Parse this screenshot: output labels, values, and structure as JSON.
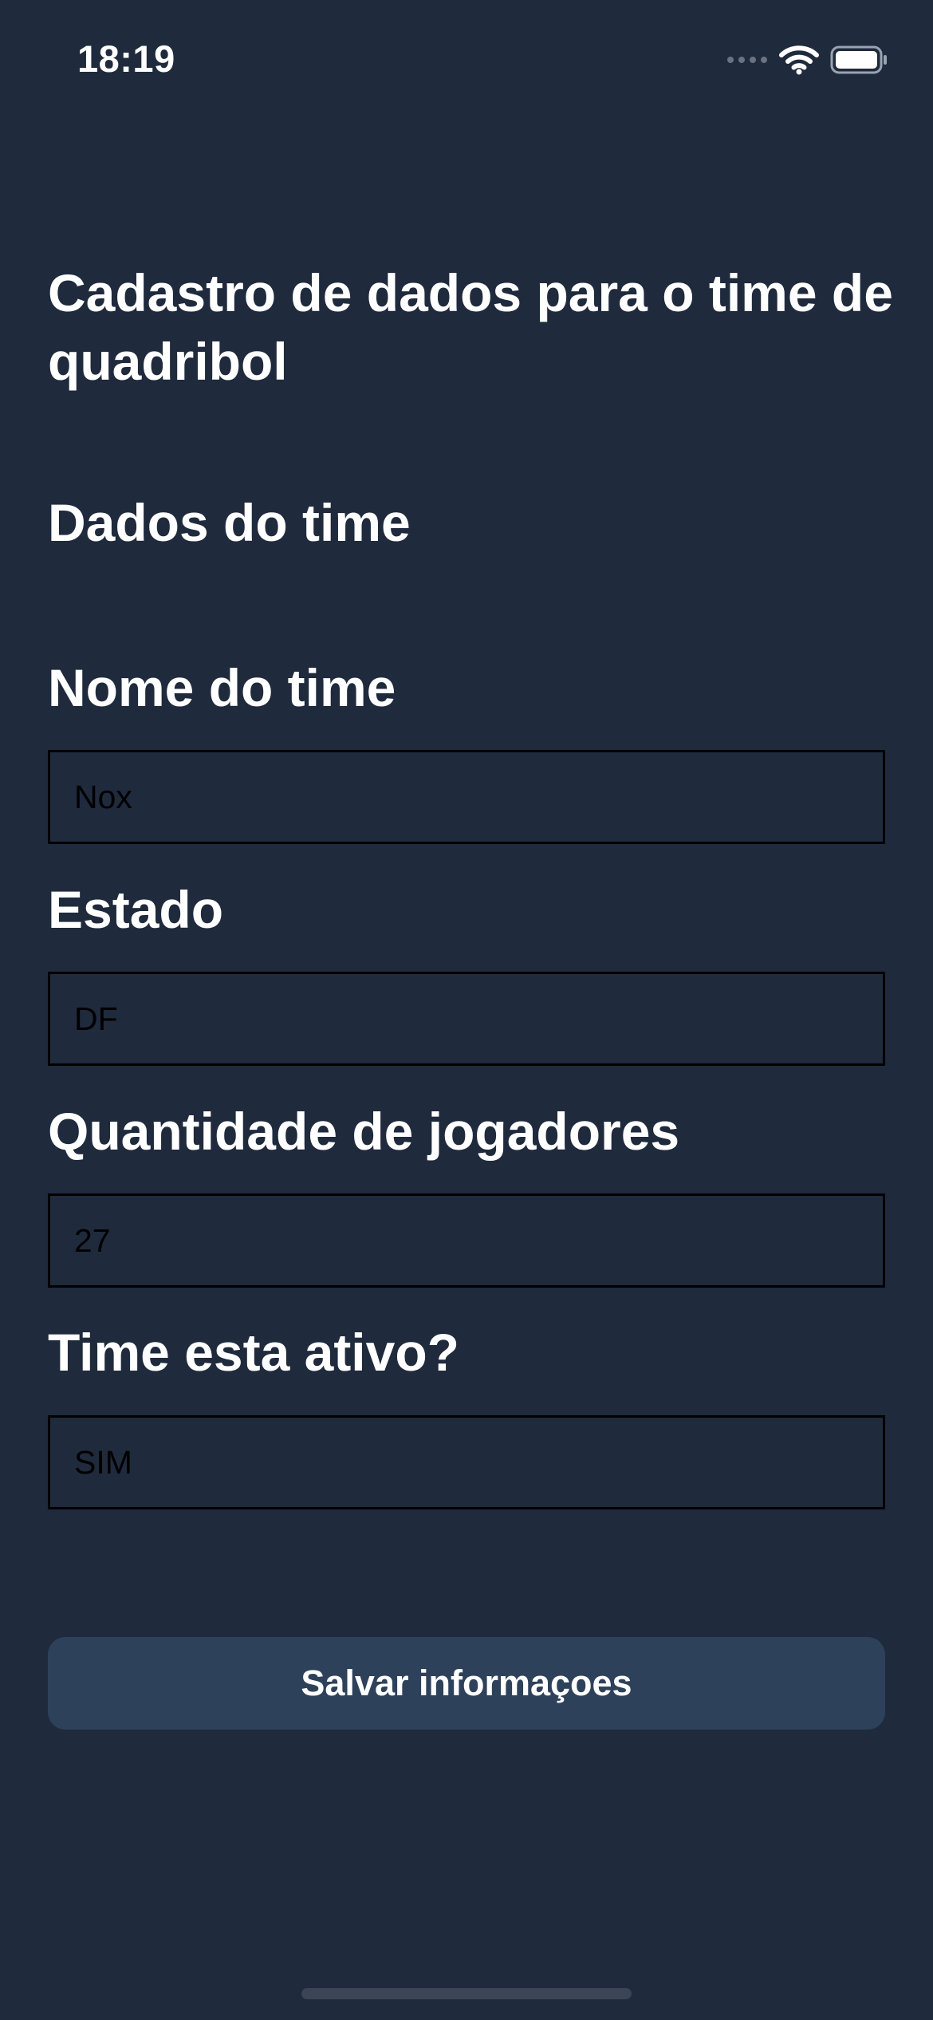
{
  "status_bar": {
    "time": "18:19",
    "icons": [
      "signal-dots-icon",
      "wifi-icon",
      "battery-icon"
    ]
  },
  "form": {
    "title": "Cadastro de dados para o time de quadribol",
    "section_title": "Dados do time",
    "fields": [
      {
        "label": "Nome do time",
        "value": "Nox"
      },
      {
        "label": "Estado",
        "value": "DF"
      },
      {
        "label": "Quantidade de jogadores",
        "value": "27"
      },
      {
        "label": "Time esta ativo?",
        "value": "SIM"
      }
    ],
    "save_label": "Salvar informaçoes"
  },
  "colors": {
    "background": "#1f2a3d",
    "button": "#2e415b",
    "text": "#ffffff",
    "input_border": "#000000"
  }
}
